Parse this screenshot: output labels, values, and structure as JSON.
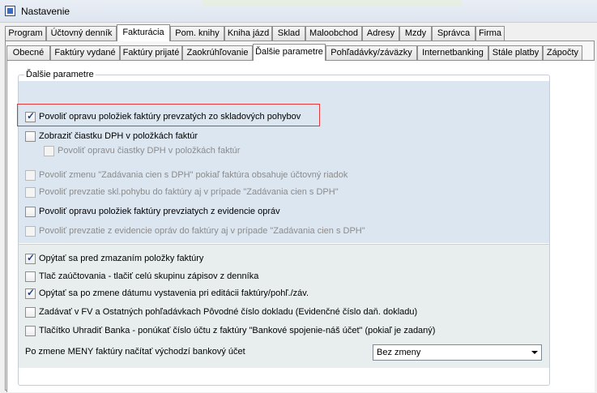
{
  "window": {
    "title": "Nastavenie"
  },
  "tabs_top": [
    {
      "label": "Program"
    },
    {
      "label": "Účtovný denník"
    },
    {
      "label": "Fakturácia"
    },
    {
      "label": "Pom. knihy"
    },
    {
      "label": "Kniha jázd"
    },
    {
      "label": "Sklad"
    },
    {
      "label": "Maloobchod"
    },
    {
      "label": "Adresy"
    },
    {
      "label": "Mzdy"
    },
    {
      "label": "Správca"
    },
    {
      "label": "Firma"
    }
  ],
  "tabs_sub": [
    {
      "label": "Obecné"
    },
    {
      "label": "Faktúry vydané"
    },
    {
      "label": "Faktúry prijaté"
    },
    {
      "label": "Zaokrúhľovanie"
    },
    {
      "label": "Ďalšie parametre"
    },
    {
      "label": "Pohľadávky/záväzky"
    },
    {
      "label": "Internetbanking"
    },
    {
      "label": "Stále platby"
    },
    {
      "label": "Zápočty"
    }
  ],
  "group": {
    "title": "Ďalšie parametre"
  },
  "options": [
    {
      "label": "Povoliť opravu položiek faktúry prevzatých zo skladových pohybov",
      "checked": true,
      "enabled": true
    },
    {
      "label": "Zobraziť čiastku DPH v položkách faktúr",
      "checked": false,
      "enabled": true
    },
    {
      "label": "Povoliť opravu čiastky DPH v položkách faktúr",
      "checked": false,
      "enabled": false
    },
    {
      "label": "Povoliť zmenu \"Zadávania cien s DPH\" pokiaľ faktúra obsahuje účtovný riadok",
      "checked": false,
      "enabled": false
    },
    {
      "label": "Povoliť prevzatie skl.pohybu do faktúry aj v prípade \"Zadávania cien s DPH\"",
      "checked": false,
      "enabled": false
    },
    {
      "label": "Povoliť opravu položiek faktúry prevziatych z evidencie opráv",
      "checked": false,
      "enabled": true
    },
    {
      "label": "Povoliť prevzatie z evidencie opráv do faktúry aj v prípade \"Zadávania cien s DPH\"",
      "checked": false,
      "enabled": false
    },
    {
      "label": "Opýtať sa pred zmazaním položky faktúry",
      "checked": true,
      "enabled": true
    },
    {
      "label": "Tlač zaúčtovania - tlačiť celú skupinu zápisov z denníka",
      "checked": false,
      "enabled": true
    },
    {
      "label": "Opýtať sa po zmene dátumu vystavenia pri editácii faktúry/pohľ./záv.",
      "checked": true,
      "enabled": true
    },
    {
      "label": "Zadávať v FV a Ostatných pohľadávkach Pôvodné číslo dokladu (Evidenčné číslo daň. dokladu)",
      "checked": false,
      "enabled": true
    },
    {
      "label": "Tlačítko Uhradiť Banka - ponúkať číslo účtu z faktúry \"Bankové spojenie-náš účet\" (pokiaľ je zadaný)",
      "checked": false,
      "enabled": true
    }
  ],
  "bank_account": {
    "label": "Po zmene MENY faktúry načítať východzí bankový účet",
    "selected": "Bez zmeny"
  },
  "colors": {
    "highlight_border": "#e23a3a",
    "section_blue": "#dce6f1"
  }
}
